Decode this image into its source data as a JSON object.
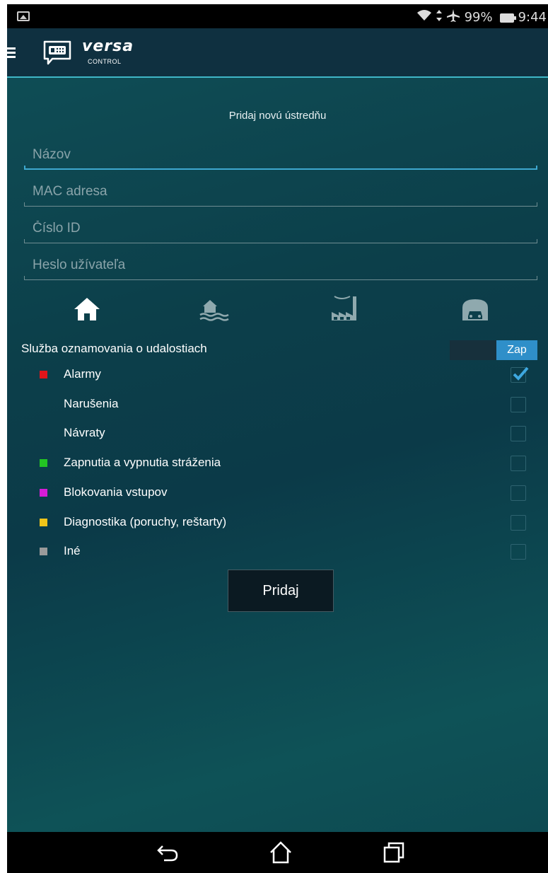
{
  "status_bar": {
    "battery": "99%",
    "time": "9:44",
    "icons": [
      "image-icon",
      "wifi-icon",
      "data-arrows-icon",
      "airplane-icon",
      "battery-icon"
    ]
  },
  "app_bar": {
    "logo_text": "versa",
    "logo_subtext": "CONTROL",
    "accent_color": "#3fb6c7"
  },
  "form": {
    "title": "Pridaj novú ústredňu",
    "fields": [
      {
        "placeholder": "Názov",
        "value": ""
      },
      {
        "placeholder": "MAC adresa",
        "value": ""
      },
      {
        "placeholder": "Číslo ID",
        "value": ""
      },
      {
        "placeholder": "Heslo užívateľa",
        "value": ""
      }
    ],
    "object_types": [
      "home-icon",
      "lake-house-icon",
      "factory-icon",
      "garage-icon"
    ],
    "selected_object_type": "home-icon"
  },
  "notifications": {
    "label": "Služba oznamovania o udalostiach",
    "toggle_on_label": "Zap",
    "events": [
      {
        "label": "Alarmy",
        "color": "#e0151a",
        "checked": true
      },
      {
        "label": "Narušenia",
        "color": "",
        "checked": false
      },
      {
        "label": "Návraty",
        "color": "",
        "checked": false
      },
      {
        "label": "Zapnutia a vypnutia stráženia",
        "color": "#23c323",
        "checked": false
      },
      {
        "label": "Blokovania vstupov",
        "color": "#d61cd6",
        "checked": false
      },
      {
        "label": "Diagnostika (poruchy, reštarty)",
        "color": "#f0c419",
        "checked": false
      },
      {
        "label": "Iné",
        "color": "#9a9a9a",
        "checked": false
      }
    ]
  },
  "actions": {
    "add_label": "Pridaj"
  },
  "nav_bar": {
    "icons": [
      "back-icon",
      "home-nav-icon",
      "recent-apps-icon"
    ]
  }
}
